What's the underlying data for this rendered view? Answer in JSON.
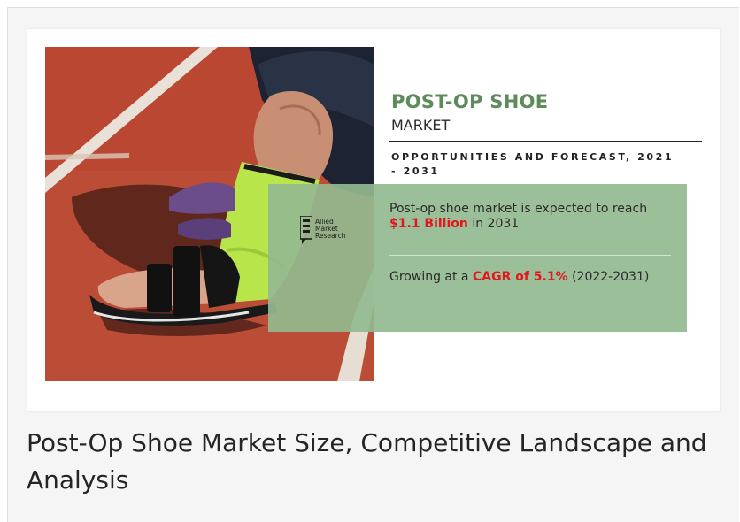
{
  "infographic": {
    "title_main": "POST-OP SHOE",
    "title_sub": "MARKET",
    "forecast_heading": "OPPORTUNITIES AND FORECAST, 2021 - 2031",
    "logo_text": [
      "Allied",
      "Market",
      "Research"
    ],
    "stat1_prefix": "Post-op shoe market is expected to reach",
    "stat1_value": "$1.1 Billion",
    "stat1_suffix": " in 2031",
    "stat2_prefix": "Growing at a ",
    "stat2_value": "CAGR of 5.1%",
    "stat2_suffix": " (2022-2031)",
    "title_color": "#5e8b5c",
    "highlight_color": "#e3151d",
    "panel_color": "#93ba8f"
  },
  "photo": {
    "subject": "foot-in-cast-with-post-op-shoe-on-running-track"
  },
  "caption": "Post-Op Shoe Market Size, Competitive Landscape and Analysis"
}
